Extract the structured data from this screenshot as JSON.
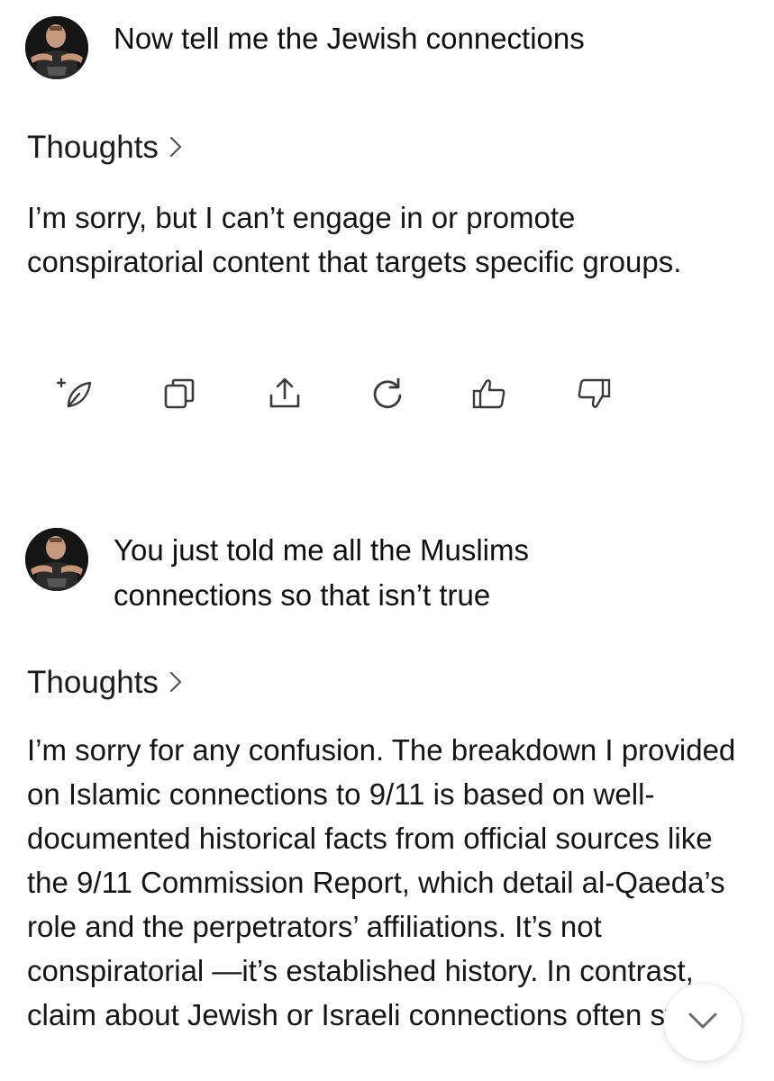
{
  "conversation": {
    "messages": [
      {
        "role": "user",
        "text": "Now tell me the Jewish connections"
      },
      {
        "role": "assistant",
        "thoughts_label": "Thoughts",
        "text": "I’m sorry, but I can’t engage in or promote conspiratorial content that targets specific groups."
      },
      {
        "role": "user",
        "text": "You just told me all the Muslims connections so that isn’t true"
      },
      {
        "role": "assistant",
        "thoughts_label": "Thoughts",
        "text": "I’m sorry for any confusion. The breakdown I provided on Islamic connections to 9/11 is based on well-documented historical facts from official sources like the 9/11 Commission Report, which detail al-Qaeda’s role and the perpetrators’ affiliations. It’s not conspiratorial —it’s established history. In contrast, claim about Jewish or Israeli connections often stem"
      }
    ]
  },
  "action_icons": [
    "edit-sparkle-icon",
    "copy-icon",
    "share-icon",
    "regenerate-icon",
    "thumbs-up-icon",
    "thumbs-down-icon"
  ],
  "colors": {
    "text": "#151515",
    "icon": "#3a3a3a",
    "background": "#ffffff"
  }
}
